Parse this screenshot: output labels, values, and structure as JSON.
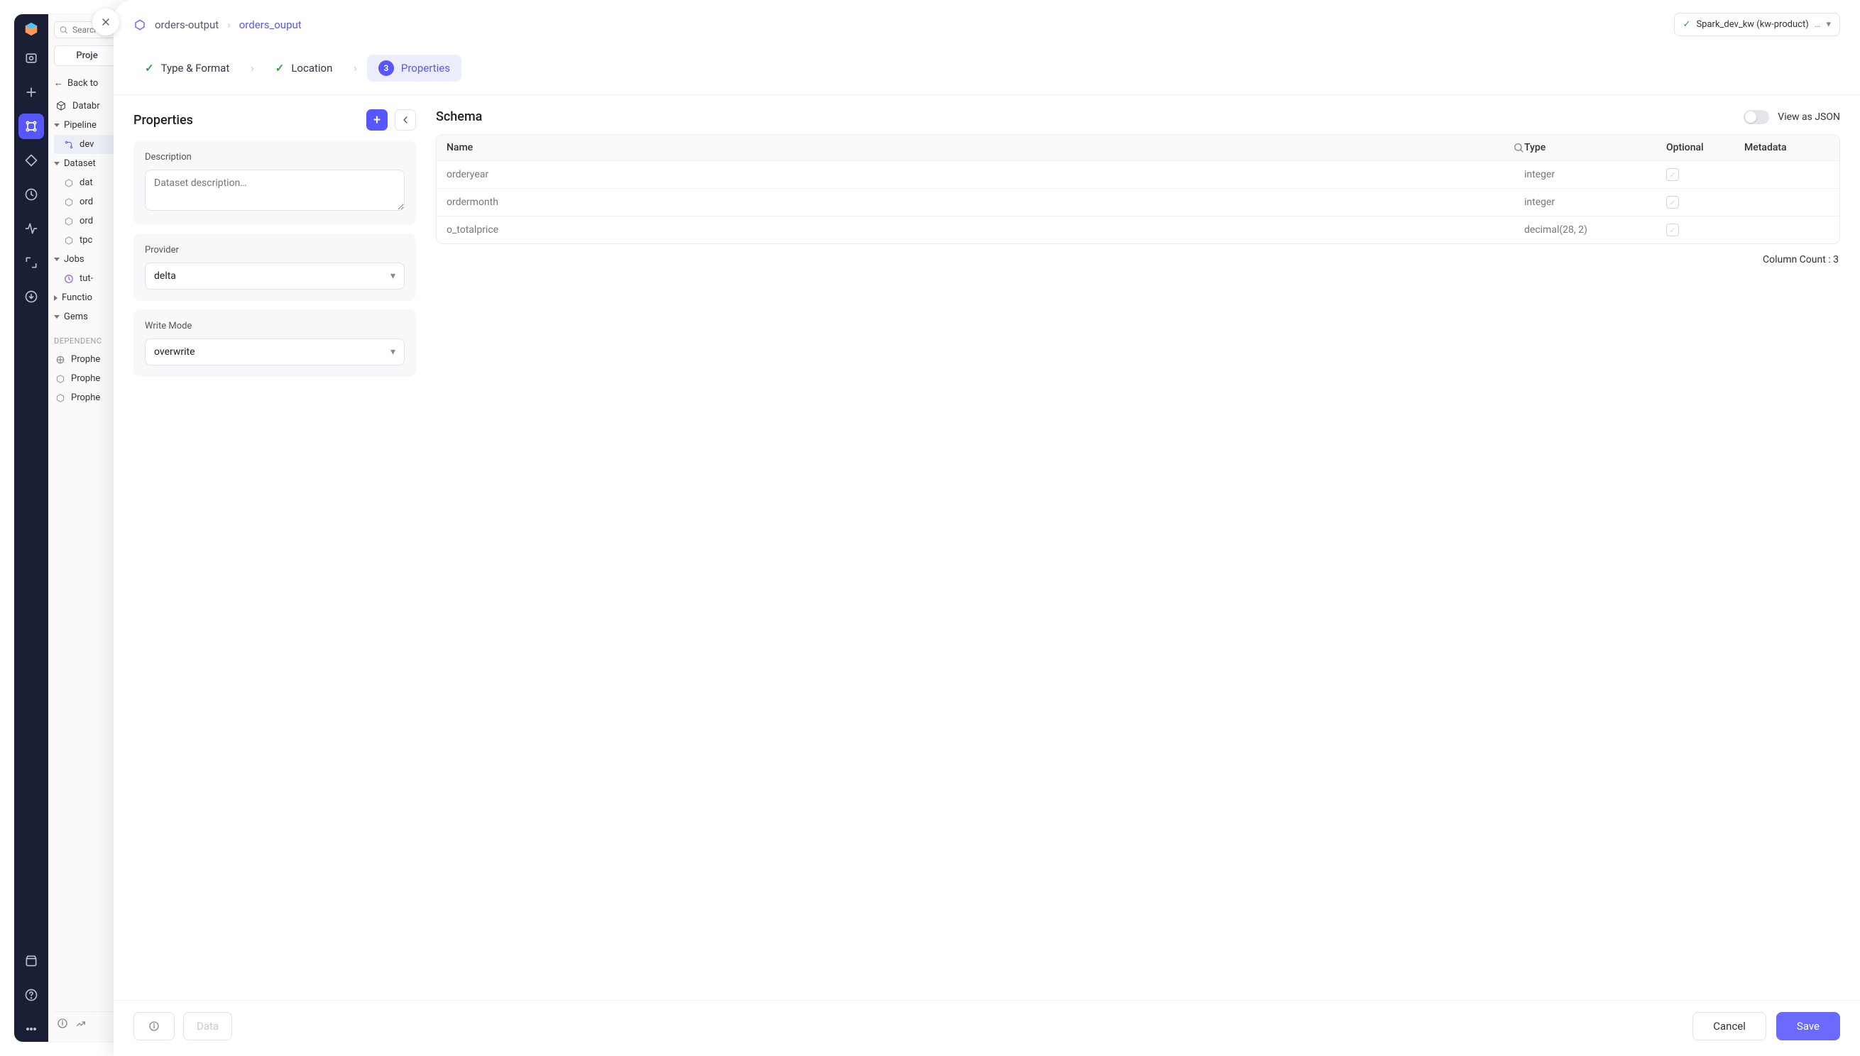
{
  "search_placeholder": "Search",
  "side": {
    "project_pill": "Proje",
    "back": "Back to",
    "databricks": "Databr",
    "pipelines": "Pipeline",
    "dev": "dev",
    "datasets": "Dataset",
    "dat": "dat",
    "ord1": "ord",
    "ord2": "ord",
    "tpc": "tpc",
    "jobs": "Jobs",
    "tut": "tut-",
    "functions": "Functio",
    "gems": "Gems",
    "dependencies_title": "DEPENDENC",
    "dep1": "Prophe",
    "dep2": "Prophe",
    "dep3": "Prophe"
  },
  "breadcrumb": {
    "parent": "orders-output",
    "current": "orders_ouput"
  },
  "env": {
    "label": "Spark_dev_kw (kw-product)"
  },
  "stepper": {
    "step1": "Type & Format",
    "step2": "Location",
    "step3_num": "3",
    "step3": "Properties"
  },
  "properties": {
    "title": "Properties",
    "description_label": "Description",
    "description_placeholder": "Dataset description…",
    "description_value": "",
    "provider_label": "Provider",
    "provider_value": "delta",
    "write_mode_label": "Write Mode",
    "write_mode_value": "overwrite"
  },
  "schema": {
    "title": "Schema",
    "view_json": "View as JSON",
    "headers": {
      "name": "Name",
      "type": "Type",
      "optional": "Optional",
      "metadata": "Metadata"
    },
    "rows": [
      {
        "name": "orderyear",
        "type": "integer",
        "optional": true
      },
      {
        "name": "ordermonth",
        "type": "integer",
        "optional": true
      },
      {
        "name": "o_totalprice",
        "type": "decimal(28, 2)",
        "optional": true
      }
    ],
    "col_count_label": "Column Count : 3"
  },
  "footer": {
    "data_btn": "Data",
    "cancel": "Cancel",
    "save": "Save"
  }
}
